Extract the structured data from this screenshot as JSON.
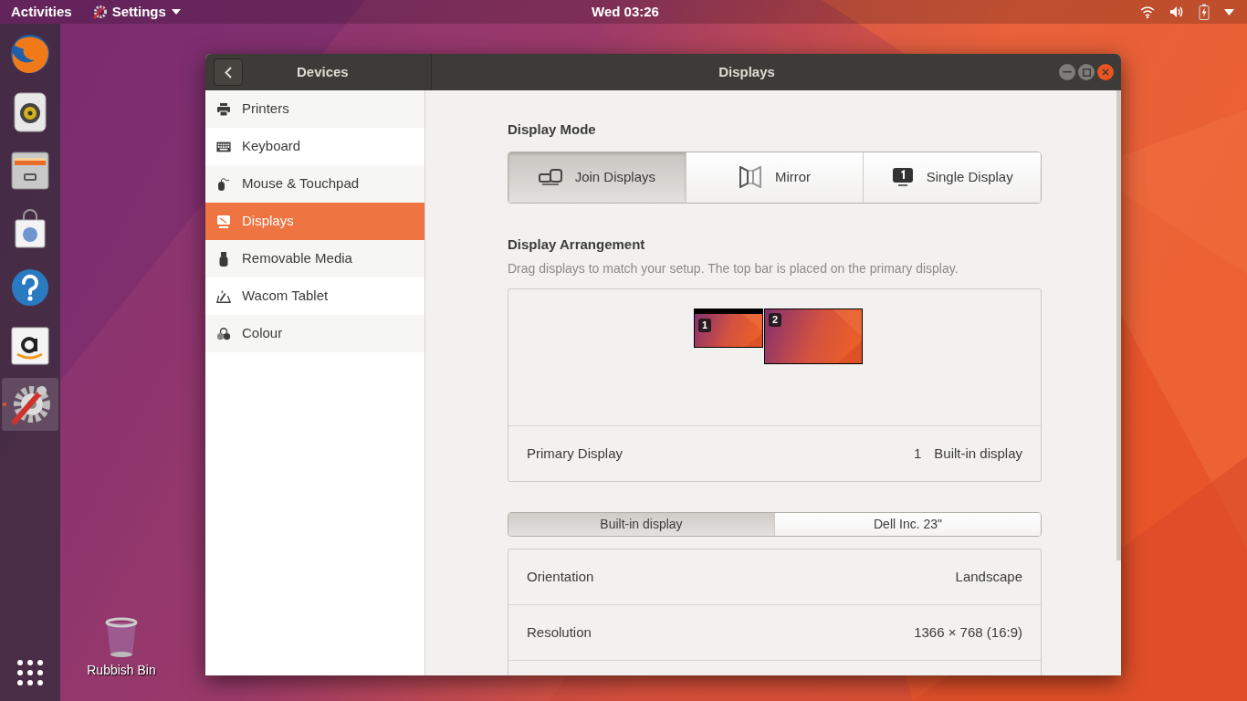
{
  "top_bar": {
    "activities": "Activities",
    "app_menu": "Settings",
    "clock": "Wed 03:26"
  },
  "dock": {
    "items": [
      {
        "kind": "browser",
        "active": false
      },
      {
        "kind": "music",
        "active": false
      },
      {
        "kind": "files",
        "active": false
      },
      {
        "kind": "store",
        "active": false
      },
      {
        "kind": "help",
        "active": false
      },
      {
        "kind": "shop",
        "active": false
      },
      {
        "kind": "settings",
        "active": true
      }
    ]
  },
  "desktop_icons": [
    {
      "label": "Rubbish Bin"
    }
  ],
  "window": {
    "sidebar_title": "Devices",
    "title": "Displays"
  },
  "sidebar": {
    "items": [
      {
        "label": "Printers",
        "kind": "printer",
        "selected": false
      },
      {
        "label": "Keyboard",
        "kind": "keyboard",
        "selected": false
      },
      {
        "label": "Mouse & Touchpad",
        "kind": "mouse",
        "selected": false
      },
      {
        "label": "Displays",
        "kind": "display",
        "selected": true
      },
      {
        "label": "Removable Media",
        "kind": "usb",
        "selected": false
      },
      {
        "label": "Wacom Tablet",
        "kind": "tablet",
        "selected": false
      },
      {
        "label": "Colour",
        "kind": "colour",
        "selected": false
      }
    ]
  },
  "display_mode": {
    "heading": "Display Mode",
    "options": [
      {
        "label": "Join Displays",
        "kind": "join",
        "selected": true
      },
      {
        "label": "Mirror",
        "kind": "mirror",
        "selected": false
      },
      {
        "label": "Single Display",
        "kind": "single",
        "selected": false
      }
    ]
  },
  "arrangement": {
    "heading": "Display Arrangement",
    "description": "Drag displays to match your setup. The top bar is placed on the primary display.",
    "monitors": [
      {
        "number": "1",
        "primary": true
      },
      {
        "number": "2",
        "primary": false
      }
    ],
    "primary_row": {
      "label": "Primary Display",
      "number": "1",
      "value": "Built-in display"
    }
  },
  "display_tabs": [
    {
      "label": "Built-in display",
      "selected": true
    },
    {
      "label": "Dell Inc. 23\"",
      "selected": false
    }
  ],
  "settings_rows": [
    {
      "label": "Orientation",
      "value": "Landscape"
    },
    {
      "label": "Resolution",
      "value": "1366 × 768 (16:9)"
    }
  ]
}
